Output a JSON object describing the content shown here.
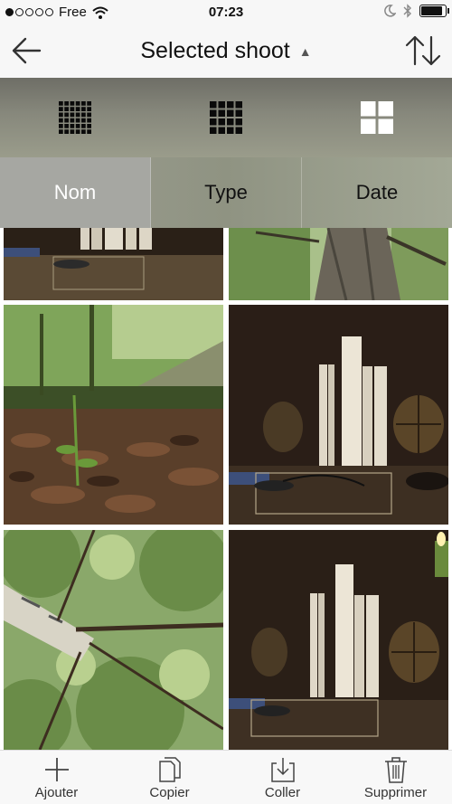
{
  "status_bar": {
    "carrier": "Free",
    "time": "07:23",
    "signal_bars_filled": 1,
    "signal_bars_total": 5,
    "battery_level_percent": 90,
    "icons": [
      "wifi-icon",
      "moon-icon",
      "bluetooth-icon",
      "battery-icon"
    ]
  },
  "nav": {
    "title": "Selected shoot",
    "title_caret": "▲",
    "back_icon": "back-arrow-icon",
    "sort_icon": "sort-arrows-icon"
  },
  "grid_size_options": [
    {
      "icon": "grid-small-icon",
      "selected": false
    },
    {
      "icon": "grid-medium-icon",
      "selected": false
    },
    {
      "icon": "grid-large-icon",
      "selected": true
    }
  ],
  "sort_tabs": [
    {
      "label": "Nom",
      "active": true
    },
    {
      "label": "Type",
      "active": false
    },
    {
      "label": "Date",
      "active": false
    }
  ],
  "photos": [
    {
      "subject": "books-on-shelf"
    },
    {
      "subject": "tree-trunk-upward"
    },
    {
      "subject": "forest-floor-leaves"
    },
    {
      "subject": "books-with-globes"
    },
    {
      "subject": "birch-tree-canopy"
    },
    {
      "subject": "books-with-globes-candle"
    }
  ],
  "toolbar": {
    "items": [
      {
        "label": "Ajouter",
        "icon": "plus-icon"
      },
      {
        "label": "Copier",
        "icon": "copy-icon"
      },
      {
        "label": "Coller",
        "icon": "paste-icon"
      },
      {
        "label": "Supprimer",
        "icon": "trash-icon"
      }
    ]
  },
  "colors": {
    "active_tab_bg": "#a6a7a2",
    "bar_bg": "#f7f7f7"
  }
}
